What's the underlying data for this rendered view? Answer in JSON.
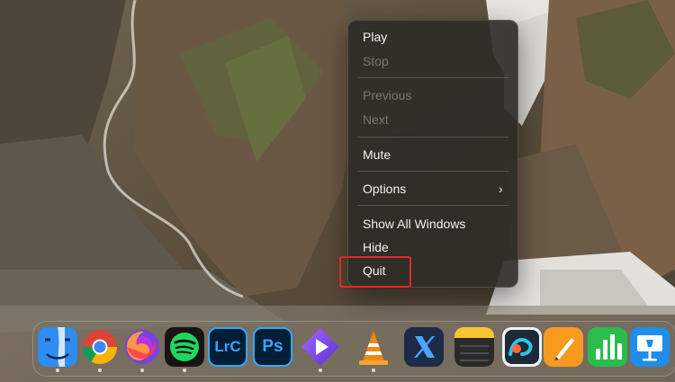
{
  "context_menu": {
    "items": [
      {
        "label": "Play",
        "enabled": true
      },
      {
        "label": "Stop",
        "enabled": false
      },
      {
        "label": "Previous",
        "enabled": false
      },
      {
        "label": "Next",
        "enabled": false
      },
      {
        "label": "Mute",
        "enabled": true
      },
      {
        "label": "Options",
        "enabled": true,
        "submenu": true
      },
      {
        "label": "Show All Windows",
        "enabled": true
      },
      {
        "label": "Hide",
        "enabled": true
      },
      {
        "label": "Quit",
        "enabled": true,
        "highlighted": true
      }
    ],
    "highlight_color": "#e3262b"
  },
  "dock": {
    "apps": [
      {
        "name": "Finder",
        "icon": "finder-icon",
        "running": true
      },
      {
        "name": "Google Chrome",
        "icon": "chrome-icon",
        "running": true
      },
      {
        "name": "Firefox",
        "icon": "firefox-icon",
        "running": true
      },
      {
        "name": "Spotify",
        "icon": "spotify-icon",
        "running": true
      },
      {
        "name": "Lightroom Classic",
        "icon": "lightroom-icon",
        "icon_text": "LrC",
        "running": false
      },
      {
        "name": "Photoshop",
        "icon": "photoshop-icon",
        "icon_text": "Ps",
        "running": false
      },
      {
        "name": "Infuse",
        "icon": "infuse-play-icon",
        "running": true
      },
      {
        "name": "VLC",
        "icon": "vlc-cone-icon",
        "running": true
      },
      {
        "name": "X",
        "icon": "x-icon",
        "running": false
      },
      {
        "name": "Notes",
        "icon": "notes-icon",
        "running": false
      },
      {
        "name": "Freeform",
        "icon": "freeform-icon",
        "running": false
      },
      {
        "name": "Pages",
        "icon": "pages-icon",
        "running": false
      },
      {
        "name": "Numbers",
        "icon": "numbers-icon",
        "running": false
      },
      {
        "name": "Keynote",
        "icon": "keynote-icon",
        "running": false
      }
    ]
  }
}
